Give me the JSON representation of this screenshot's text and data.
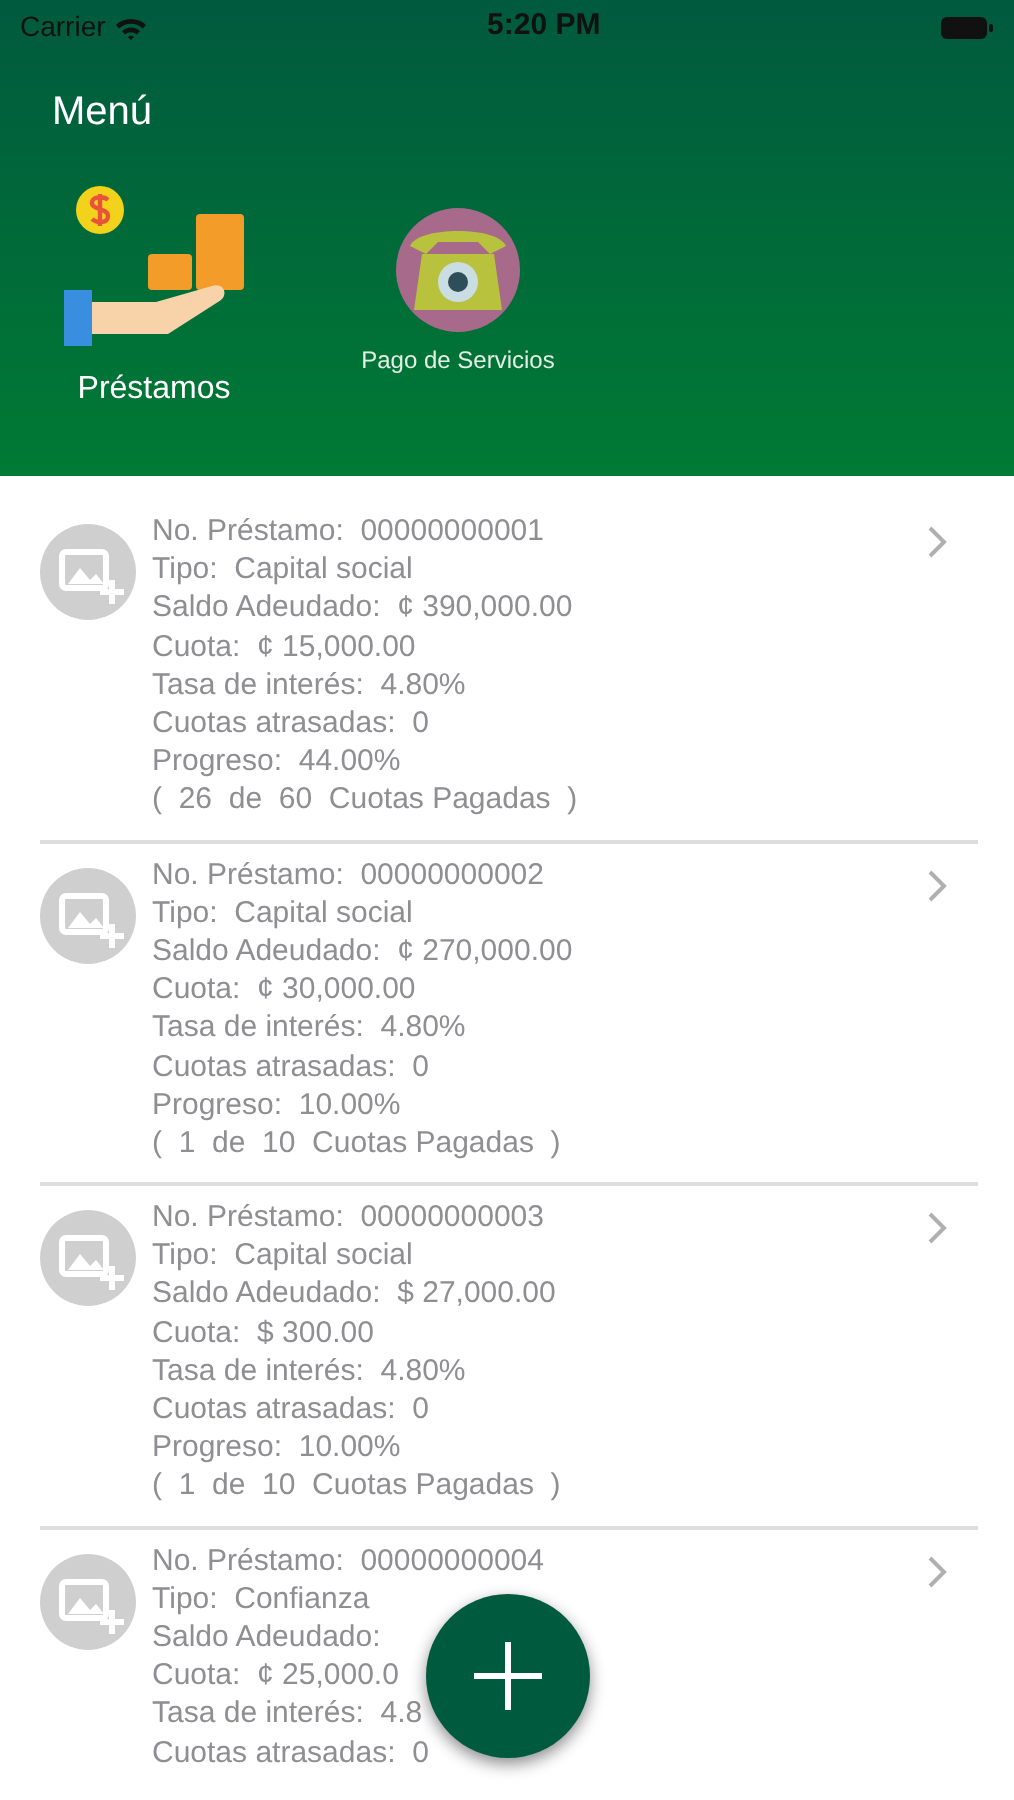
{
  "status_bar": {
    "carrier": "Carrier",
    "time": "5:20 PM"
  },
  "header": {
    "title": "Menú",
    "menu_items": [
      {
        "label": "Préstamos",
        "kind": "loans",
        "selected": true
      },
      {
        "label": "Pago de Servicios",
        "kind": "services",
        "selected": false
      }
    ]
  },
  "loans": [
    {
      "lines": [
        "No. Préstamo:  00000000001",
        "Tipo:  Capital social",
        "Saldo Adeudado:  ¢ 390,000.00",
        "Cuota:  ¢ 15,000.00",
        "Tasa de interés:  4.80%",
        "Cuotas atrasadas:  0",
        "Progreso:  44.00%",
        "(  26  de  60  Cuotas Pagadas  )"
      ]
    },
    {
      "lines": [
        "No. Préstamo:  00000000002",
        "Tipo:  Capital social",
        "Saldo Adeudado:  ¢ 270,000.00",
        "Cuota:  ¢ 30,000.00",
        "Tasa de interés:  4.80%",
        "Cuotas atrasadas:  0",
        "Progreso:  10.00%",
        "(  1  de  10  Cuotas Pagadas  )"
      ]
    },
    {
      "lines": [
        "No. Préstamo:  00000000003",
        "Tipo:  Capital social",
        "Saldo Adeudado:  $ 27,000.00",
        "Cuota:  $ 300.00",
        "Tasa de interés:  4.80%",
        "Cuotas atrasadas:  0",
        "Progreso:  10.00%",
        "(  1  de  10  Cuotas Pagadas  )"
      ]
    },
    {
      "lines": [
        "No. Préstamo:  00000000004",
        "Tipo:  Confianza",
        "Saldo Adeudado:",
        "Cuota:  ¢ 25,000.0",
        "Tasa de interés:  4.8",
        "Cuotas atrasadas:  0"
      ]
    }
  ]
}
